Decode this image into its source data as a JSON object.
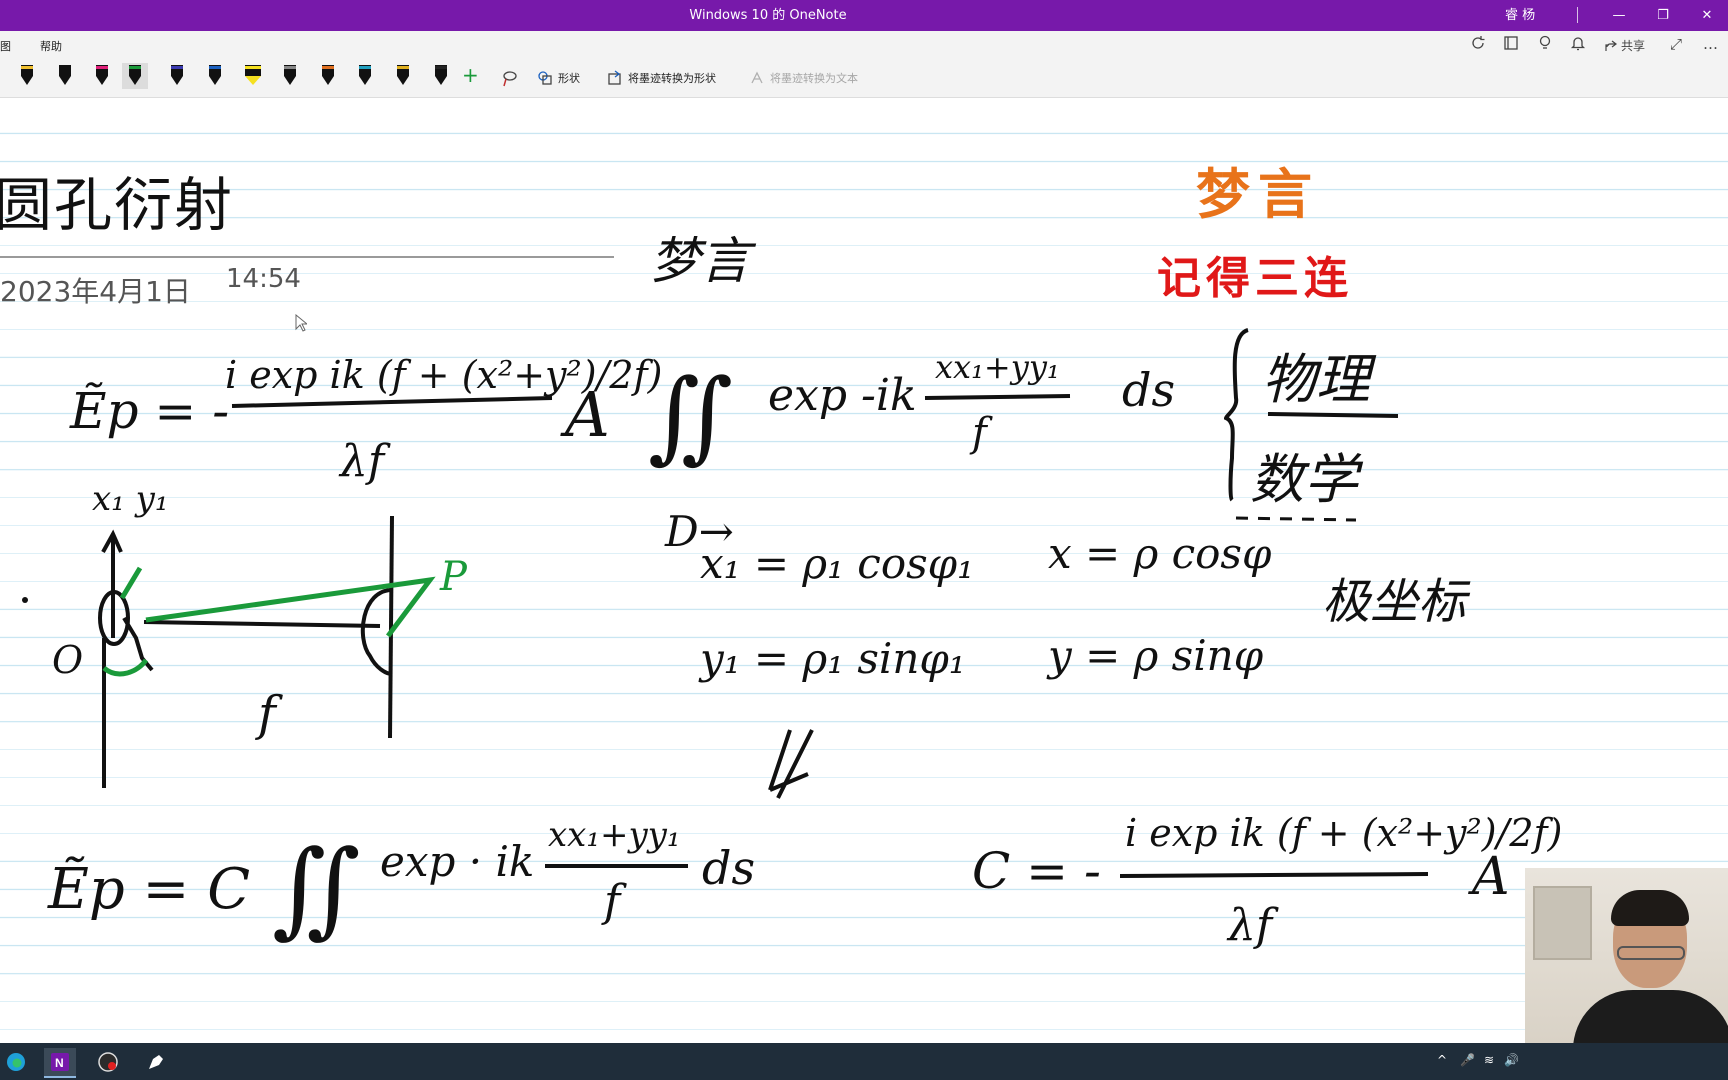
{
  "window": {
    "title": "Windows 10 的 OneNote",
    "user": "睿 杨",
    "minimize": "—",
    "restore": "❐",
    "close": "✕"
  },
  "menu": {
    "items": [
      "图",
      "帮助"
    ],
    "right_icons": [
      "sync-icon",
      "notebook-icon",
      "lightbulb-icon",
      "bell-icon"
    ],
    "share_label": "共享",
    "more": "…",
    "expand": "⤢"
  },
  "toolbar": {
    "pens": [
      {
        "color": "#111111",
        "accent": "#f0c030"
      },
      {
        "color": "#111111",
        "accent": "#111111"
      },
      {
        "color": "#111111",
        "accent": "#e0207a"
      },
      {
        "color": "#111111",
        "accent": "#1a9a3a",
        "selected": true
      },
      {
        "color": "#111111",
        "accent": "#3a3ab0"
      },
      {
        "color": "#111111",
        "accent": "#1a60c0"
      },
      {
        "color": "#111111",
        "accent": "#f5e020",
        "highlighter": true
      },
      {
        "color": "#111111",
        "accent": "#888888"
      },
      {
        "color": "#111111",
        "accent": "#e07020"
      },
      {
        "color": "#111111",
        "accent": "#20a0c0"
      },
      {
        "color": "#111111",
        "accent": "#e0b020"
      },
      {
        "color": "#111111",
        "accent": "#222222"
      }
    ],
    "add_pen": "+",
    "shapes_label": "形状",
    "ink_to_shape_label": "将墨迹转换为形状",
    "ink_to_text_label": "将墨迹转换为文本"
  },
  "page": {
    "title": "圆孔衍射",
    "date": "2023年4月1日",
    "time": "14:54"
  },
  "watermark": {
    "line1": "梦言",
    "line2": "记得三连",
    "color1": "#e8731a",
    "color2": "#e01818"
  },
  "ink": {
    "signature": "梦言",
    "physics": "物理",
    "math": "数学",
    "polar": "极坐标",
    "eq1_left": "Ẽp = -",
    "eq1_num": "i exp ik (f + (x²+y²)/2f)",
    "eq1_den": "λf",
    "eq1_A": "A",
    "eq1_int": "∬",
    "eq1_D": "D→",
    "eq1_exp": "exp -ik",
    "eq1_frac_num": "xx₁+yy₁",
    "eq1_frac_den": "f",
    "eq1_ds": "ds",
    "x1y1": "x₁ y₁",
    "label_O": "O",
    "label_P": "P",
    "label_f": "f",
    "x1_eq": "x₁ = ρ₁ cosφ₁",
    "y1_eq": "y₁ = ρ₁ sinφ₁",
    "x_eq": "x = ρ cosφ",
    "y_eq": "y = ρ sinφ",
    "eq2_left": "Ẽp = C",
    "eq2_int": "∬",
    "eq2_exp": "exp · ik",
    "eq2_frac_num": "xx₁+yy₁",
    "eq2_frac_den": "f",
    "eq2_ds": "ds",
    "C_left": "C = -",
    "C_num": "i exp ik (f + (x²+y²)/2f)",
    "C_den": "λf",
    "C_A": "A",
    "green": "#1a9a3a"
  },
  "taskbar": {
    "apps": [
      "edge-icon",
      "onenote-icon",
      "recorder-icon",
      "pen-app-icon"
    ],
    "tray": [
      "^",
      "🎤",
      "≋",
      "🔊"
    ]
  }
}
